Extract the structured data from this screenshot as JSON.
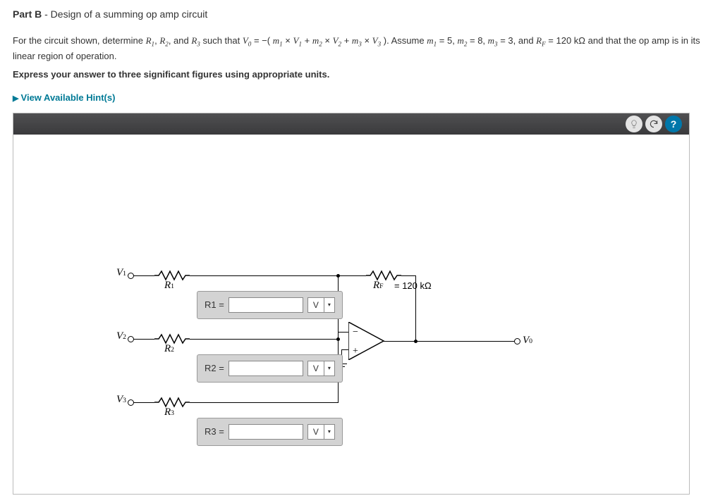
{
  "header": {
    "part_label": "Part B",
    "part_title": " - Design of a summing op amp circuit"
  },
  "problem": {
    "line1_prefix": "For the circuit shown, determine ",
    "r1": "R",
    "r1s": "1",
    "sep1": ", ",
    "r2": "R",
    "r2s": "2",
    "sep2": ", and ",
    "r3": "R",
    "r3s": "3",
    "mid1": " such that ",
    "v0": "V",
    "v0s": "0",
    "eq": " = −(",
    "m1": "m",
    "m1s": "1",
    "x1": " × ",
    "v1": "V",
    "v1s": "1",
    "p1": " + ",
    "m2": "m",
    "m2s": "2",
    "x2": " × ",
    "v2": "V",
    "v2s": "2",
    "p2": " + ",
    "m3": "m",
    "m3s": "3",
    "x3": " × ",
    "v3": "V",
    "v3s": "3",
    "close": "). Assume ",
    "am1": "m",
    "am1s": "1",
    "av1": " = 5, ",
    "am2": "m",
    "am2s": "2",
    "av2": " = 8, ",
    "am3": "m",
    "am3s": "3",
    "av3": " = 3, and ",
    "rf": "R",
    "rfs": "F",
    "rfv": " = 120 kΩ and that the op amp is in its linear region of operation.",
    "instruct": "Express your answer to three significant figures using appropriate units."
  },
  "hints_label": "View Available Hint(s)",
  "toolbar": {
    "bulb_name": "hint-bulb-icon",
    "reset_name": "reset-icon",
    "help_label": "?"
  },
  "circuit": {
    "v_in": [
      "V₁",
      "V₂",
      "V₃"
    ],
    "v1": "V",
    "v1s": "1",
    "v2": "V",
    "v2s": "2",
    "v3": "V",
    "v3s": "3",
    "r_in": [
      "R₁",
      "R₂",
      "R₃"
    ],
    "r1": "R",
    "r1s": "1",
    "r2": "R",
    "r2s": "2",
    "r3": "R",
    "r3s": "3",
    "rf": "R",
    "rfs": "F",
    "rf_value": "= 120 kΩ",
    "v0": "V",
    "v0s": "0"
  },
  "inputs": {
    "r1": {
      "label": "R1 =",
      "value": "",
      "unit": "V"
    },
    "r2": {
      "label": "R2 =",
      "value": "",
      "unit": "V"
    },
    "r3": {
      "label": "R3 =",
      "value": "",
      "unit": "V"
    }
  }
}
